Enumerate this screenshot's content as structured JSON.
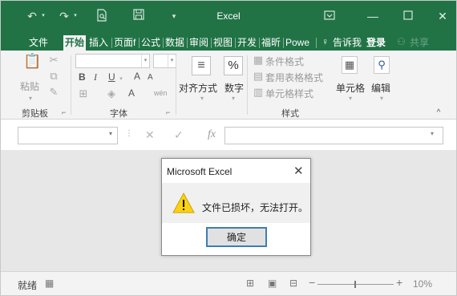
{
  "window": {
    "title": "Excel"
  },
  "titlebar_icons": [
    "undo-icon",
    "redo-icon",
    "print-preview-icon",
    "save-icon",
    "customize-qat-icon",
    "ribbon-display-icon",
    "minimize-icon",
    "maximize-icon",
    "close-icon"
  ],
  "tabs": [
    {
      "label": "文件"
    },
    {
      "label": "开始"
    },
    {
      "label": "插入"
    },
    {
      "label": "页面f"
    },
    {
      "label": "公式"
    },
    {
      "label": "数据"
    },
    {
      "label": "审阅"
    },
    {
      "label": "视图"
    },
    {
      "label": "开发"
    },
    {
      "label": "福昕"
    },
    {
      "label": "Powe"
    }
  ],
  "tell_me": "告诉我",
  "login": "登录",
  "share": "共享",
  "ribbon": {
    "clipboard": {
      "paste": "粘贴",
      "group_label": "剪贴板"
    },
    "font": {
      "bold": "B",
      "italic": "I",
      "underline": "U",
      "grow": "A",
      "shrink": "A",
      "font_color": "A",
      "phonetic": "wén",
      "group_label": "字体"
    },
    "alignment": {
      "label": "对齐方式"
    },
    "number": {
      "label": "数字",
      "symbol": "%"
    },
    "styles": {
      "conditional": "条件格式",
      "table": "套用表格格式",
      "cell": "单元格样式",
      "group_label": "样式"
    },
    "cells": {
      "label": "单元格"
    },
    "editing": {
      "label": "编辑"
    }
  },
  "formula_bar": {
    "name_box": "",
    "fx": "fx",
    "formula": ""
  },
  "dialog": {
    "title": "Microsoft Excel",
    "message": "文件已损坏，无法打开。",
    "ok": "确定"
  },
  "status": {
    "ready": "就绪",
    "zoom": "10%"
  }
}
